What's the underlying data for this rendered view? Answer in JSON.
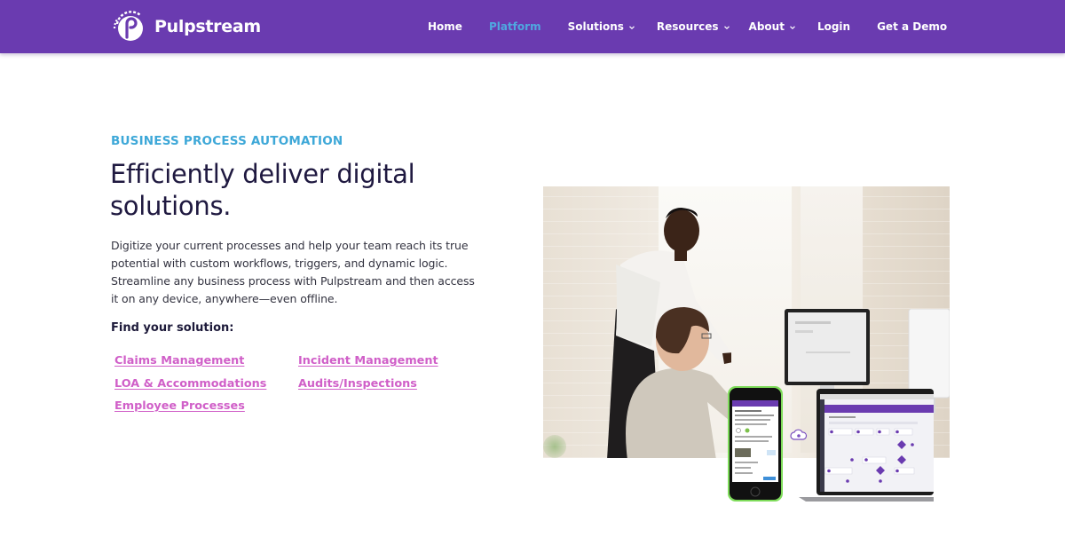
{
  "brand": {
    "name": "Pulpstream",
    "logo_icon": "pulpstream-p-logo-icon",
    "nav_color": "#6a3bb0",
    "accent_blue": "#3ea8d8",
    "link_pink": "#d05fc8"
  },
  "nav": {
    "items": [
      {
        "label": "Home",
        "has_dropdown": false,
        "active": false
      },
      {
        "label": "Platform",
        "has_dropdown": false,
        "active": true
      },
      {
        "label": "Solutions",
        "has_dropdown": true,
        "active": false
      },
      {
        "label": "Resources",
        "has_dropdown": true,
        "active": false
      },
      {
        "label": "About",
        "has_dropdown": true,
        "active": false
      },
      {
        "label": "Login",
        "has_dropdown": false,
        "active": false
      },
      {
        "label": "Get a Demo",
        "has_dropdown": false,
        "active": false
      }
    ],
    "dropdown_icon": "chevron-down-icon"
  },
  "hero": {
    "eyebrow": "BUSINESS PROCESS AUTOMATION",
    "headline": "Efficiently deliver digital solutions.",
    "body": "Digitize your current processes and help your team reach its true potential with custom workflows, triggers, and dynamic logic. Streamline any business process with Pulpstream and then access it on any device, anywhere—even offline.",
    "find_label": "Find your solution:",
    "solutions": [
      "Claims Management",
      "Incident Management",
      "LOA & Accommodations",
      "Audits/Inspections",
      "Employee Processes"
    ],
    "image": {
      "description": "Two colleagues at a desk looking at a monitor, with phone and laptop showing Pulpstream app workflow",
      "phone_icon": "smartphone-app-icon",
      "laptop_icon": "laptop-workflow-icon",
      "cloud_icon": "cloud-sync-icon"
    }
  }
}
